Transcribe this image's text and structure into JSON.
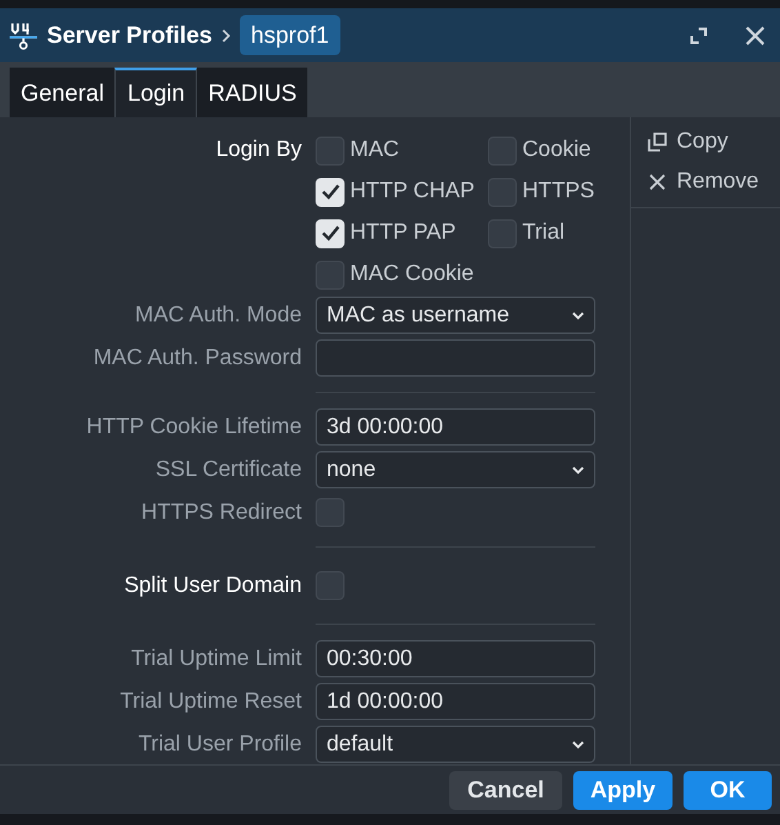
{
  "window": {
    "title": "Server Profiles",
    "breadcrumb": "hsprof1"
  },
  "tabs": [
    {
      "label": "General",
      "selected": false
    },
    {
      "label": "Login",
      "selected": true
    },
    {
      "label": "RADIUS",
      "selected": false
    }
  ],
  "sections": [
    [
      {
        "kind": "checkgroup",
        "label": "Login By",
        "emphasis": true,
        "options": [
          {
            "label": "MAC",
            "checked": false
          },
          {
            "label": "Cookie",
            "checked": false
          },
          {
            "label": "HTTP CHAP",
            "checked": true
          },
          {
            "label": "HTTPS",
            "checked": false
          },
          {
            "label": "HTTP PAP",
            "checked": true
          },
          {
            "label": "Trial",
            "checked": false
          },
          {
            "label": "MAC Cookie",
            "checked": false
          }
        ]
      },
      {
        "kind": "select",
        "label": "MAC Auth. Mode",
        "emphasis": false,
        "value": "MAC as username"
      },
      {
        "kind": "text",
        "label": "MAC Auth. Password",
        "emphasis": false
      }
    ],
    [
      {
        "kind": "text",
        "label": "HTTP Cookie Lifetime",
        "emphasis": false,
        "value": "3d 00:00:00"
      },
      {
        "kind": "select",
        "label": "SSL Certificate",
        "emphasis": false,
        "value": "none"
      },
      {
        "kind": "checkbox",
        "label": "HTTPS Redirect",
        "emphasis": false,
        "checked": false
      }
    ],
    [
      {
        "kind": "checkbox",
        "label": "Split User Domain",
        "emphasis": true,
        "checked": false
      }
    ],
    [
      {
        "kind": "text",
        "label": "Trial Uptime Limit",
        "emphasis": false,
        "value": "00:30:00"
      },
      {
        "kind": "text",
        "label": "Trial Uptime Reset",
        "emphasis": false,
        "value": "1d 00:00:00"
      },
      {
        "kind": "select",
        "label": "Trial User Profile",
        "emphasis": false,
        "value": "default"
      }
    ]
  ],
  "side_actions": [
    {
      "kind": "copy",
      "label": "Copy"
    },
    {
      "kind": "remove",
      "label": "Remove"
    }
  ],
  "buttons": [
    {
      "kind": "secondary",
      "label": "Cancel"
    },
    {
      "kind": "primary",
      "label": "Apply"
    },
    {
      "kind": "primary",
      "label": "OK"
    }
  ]
}
